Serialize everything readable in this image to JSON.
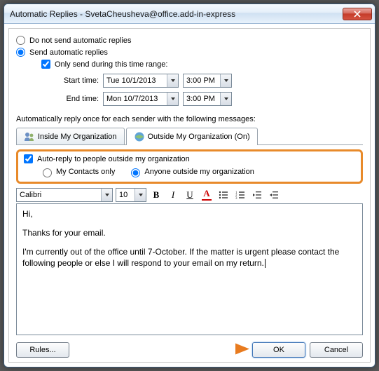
{
  "window": {
    "title": "Automatic Replies - SvetaCheusheva@office.add-in-express"
  },
  "options": {
    "dont_send": "Do not send automatic replies",
    "send": "Send automatic replies",
    "only_range": "Only send during this time range:",
    "start_label": "Start time:",
    "end_label": "End time:",
    "start_date": "Tue 10/1/2013",
    "start_time": "3:00 PM",
    "end_date": "Mon 10/7/2013",
    "end_time": "3:00 PM"
  },
  "section_text": "Automatically reply once for each sender with the following messages:",
  "tabs": {
    "inside": "Inside My Organization",
    "outside": "Outside My Organization (On)"
  },
  "outside_opts": {
    "enable": "Auto-reply to people outside my organization",
    "contacts_only": "My Contacts only",
    "anyone": "Anyone outside my organization"
  },
  "format": {
    "font": "Calibri",
    "size": "10"
  },
  "message": {
    "p1": "Hi,",
    "p2": "Thanks for your email.",
    "p3": "I'm currently out of the office until 7-October. If the matter is urgent please contact the following people or else I will respond to your email on my return."
  },
  "buttons": {
    "rules": "Rules...",
    "ok": "OK",
    "cancel": "Cancel"
  }
}
